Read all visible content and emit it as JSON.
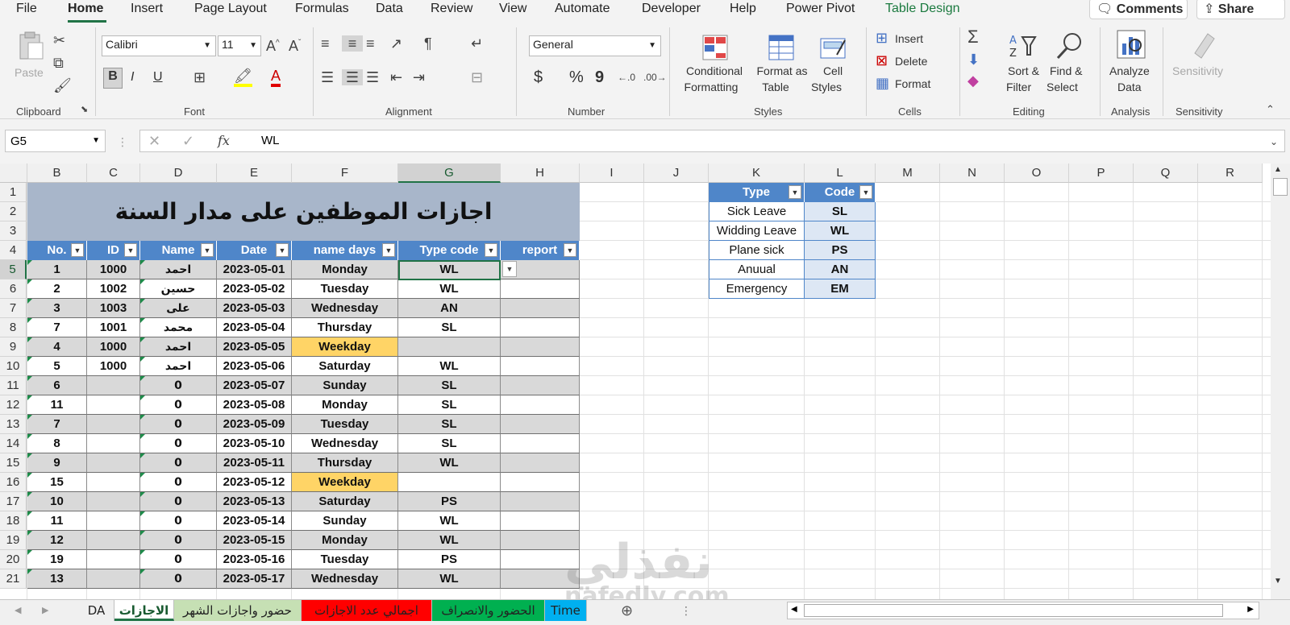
{
  "menu": {
    "tabs": [
      "File",
      "Home",
      "Insert",
      "Page Layout",
      "Formulas",
      "Data",
      "Review",
      "View",
      "Automate",
      "Developer",
      "Help",
      "Power Pivot",
      "Table Design"
    ],
    "comments": "Comments",
    "share": "Share"
  },
  "ribbon": {
    "clipboard": {
      "paste": "Paste",
      "group": "Clipboard"
    },
    "font": {
      "name": "Calibri",
      "size": "11",
      "group": "Font",
      "bold": "B",
      "italic": "I",
      "underline": "U"
    },
    "alignment": {
      "group": "Alignment"
    },
    "number": {
      "format": "General",
      "currency": "$",
      "percent": "%",
      "comma": "9",
      "group": "Number"
    },
    "styles": {
      "conditional_1": "Conditional",
      "conditional_2": "Formatting",
      "format_table_1": "Format as",
      "format_table_2": "Table",
      "cell_styles_1": "Cell",
      "cell_styles_2": "Styles",
      "group": "Styles"
    },
    "cells": {
      "insert": "Insert",
      "delete": "Delete",
      "format": "Format",
      "group": "Cells"
    },
    "editing": {
      "sort_1": "Sort &",
      "sort_2": "Filter",
      "find_1": "Find &",
      "find_2": "Select",
      "group": "Editing"
    },
    "analysis": {
      "analyze_1": "Analyze",
      "analyze_2": "Data",
      "group": "Analysis"
    },
    "sensitivity": {
      "label": "Sensitivity",
      "group": "Sensitivity"
    }
  },
  "formula_bar": {
    "name_box": "G5",
    "fx": "fx",
    "value": "WL"
  },
  "columns": [
    "B",
    "C",
    "D",
    "E",
    "F",
    "G",
    "H",
    "I",
    "J",
    "K",
    "L",
    "M",
    "N",
    "O",
    "P",
    "Q",
    "R"
  ],
  "rows": [
    "1",
    "2",
    "3",
    "4",
    "5",
    "6",
    "7",
    "8",
    "9",
    "10",
    "11",
    "12",
    "13",
    "14",
    "15",
    "16",
    "17",
    "18",
    "19",
    "20",
    "21"
  ],
  "title": "اجازات الموظفين على مدار السنة",
  "table": {
    "headers": [
      "No.",
      "ID",
      "Name",
      "Date",
      "name days",
      "Type code",
      "report"
    ],
    "rows": [
      [
        "1",
        "1000",
        "احمد",
        "2023-05-01",
        "Monday",
        "WL",
        ""
      ],
      [
        "2",
        "1002",
        "حسين",
        "2023-05-02",
        "Tuesday",
        "WL",
        ""
      ],
      [
        "3",
        "1003",
        "على",
        "2023-05-03",
        "Wednesday",
        "AN",
        ""
      ],
      [
        "7",
        "1001",
        "محمد",
        "2023-05-04",
        "Thursday",
        "SL",
        ""
      ],
      [
        "4",
        "1000",
        "احمد",
        "2023-05-05",
        "Weekday",
        "",
        ""
      ],
      [
        "5",
        "1000",
        "احمد",
        "2023-05-06",
        "Saturday",
        "WL",
        ""
      ],
      [
        "6",
        "",
        "0",
        "2023-05-07",
        "Sunday",
        "SL",
        ""
      ],
      [
        "11",
        "",
        "0",
        "2023-05-08",
        "Monday",
        "SL",
        ""
      ],
      [
        "7",
        "",
        "0",
        "2023-05-09",
        "Tuesday",
        "SL",
        ""
      ],
      [
        "8",
        "",
        "0",
        "2023-05-10",
        "Wednesday",
        "SL",
        ""
      ],
      [
        "9",
        "",
        "0",
        "2023-05-11",
        "Thursday",
        "WL",
        ""
      ],
      [
        "15",
        "",
        "0",
        "2023-05-12",
        "Weekday",
        "",
        ""
      ],
      [
        "10",
        "",
        "0",
        "2023-05-13",
        "Saturday",
        "PS",
        ""
      ],
      [
        "11",
        "",
        "0",
        "2023-05-14",
        "Sunday",
        "WL",
        ""
      ],
      [
        "12",
        "",
        "0",
        "2023-05-15",
        "Monday",
        "WL",
        ""
      ],
      [
        "19",
        "",
        "0",
        "2023-05-16",
        "Tuesday",
        "PS",
        ""
      ],
      [
        "13",
        "",
        "0",
        "2023-05-17",
        "Wednesday",
        "WL",
        ""
      ]
    ]
  },
  "lookup": {
    "headers": [
      "Type",
      "Code"
    ],
    "rows": [
      [
        "Sick Leave",
        "SL"
      ],
      [
        "Widding Leave",
        "WL"
      ],
      [
        "Plane sick",
        "PS"
      ],
      [
        "Anuual",
        "AN"
      ],
      [
        "Emergency",
        "EM"
      ]
    ]
  },
  "sheet_tabs": [
    "DA",
    "الاجازات",
    "حضور واجازات الشهر",
    "اجمالي عدد الاجازات",
    "الحضور والانصراف",
    "Time"
  ],
  "sheet_tab_colors": [
    "#f0f0f0",
    "#ffffff",
    "#c6e0b4",
    "#ff0000",
    "#00b050",
    "#00b0f0"
  ],
  "watermark": {
    "arabic": "نفذلي",
    "latin": "nafedly.com"
  }
}
